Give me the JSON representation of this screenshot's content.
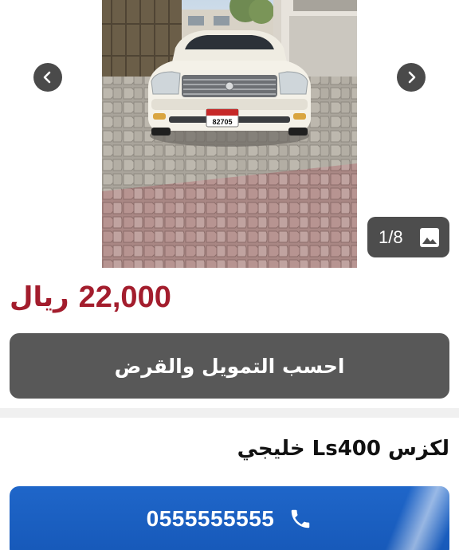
{
  "gallery": {
    "counter_text": "1/8",
    "plate_text": "82705",
    "icons": {
      "previous": "chevron-left-icon",
      "next": "chevron-right-icon",
      "counter": "image-icon"
    }
  },
  "listing": {
    "price_value": "22,000",
    "price_currency": "ريال",
    "finance_button_label": "احسب التمويل والقرض",
    "title": "لكزس Ls400 خليجي",
    "phone_number": "0555555555",
    "phone_icon": "phone-icon"
  },
  "colors": {
    "price": "#a31d2d",
    "finance_button": "#585858",
    "call_button": "#1f66c9",
    "nav_button": "#4a4a4a"
  }
}
